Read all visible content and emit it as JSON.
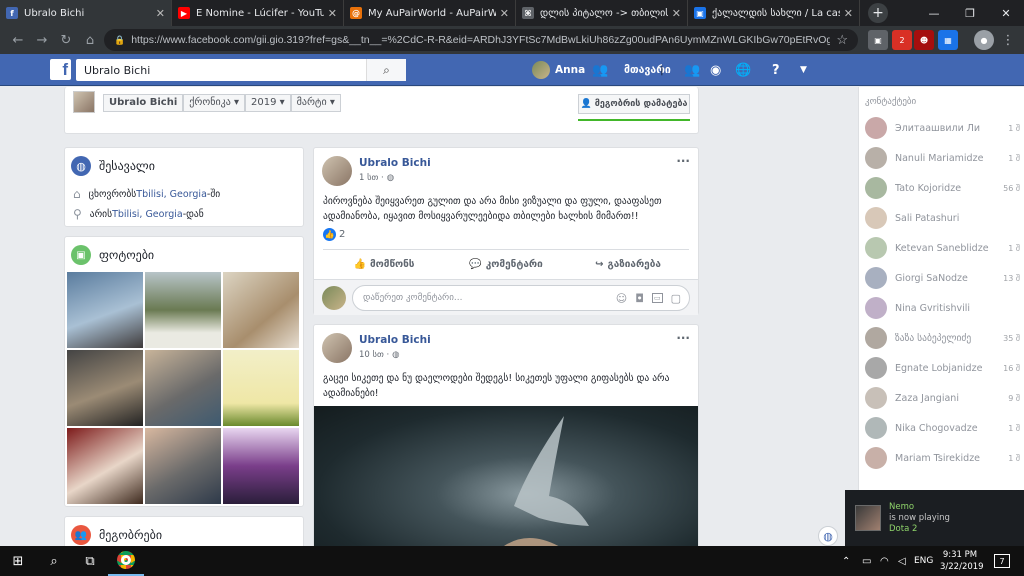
{
  "browser": {
    "tabs": [
      {
        "title": "Ubralo Bichi",
        "fav_color": "#4267b2",
        "fav_glyph": "f",
        "active": true
      },
      {
        "title": "E Nomine - Lúcifer - YouTube",
        "fav_color": "#ff0000",
        "fav_glyph": "▶",
        "active": false
      },
      {
        "title": "My AuPairWorld - AuPairWorld",
        "fav_color": "#e8710a",
        "fav_glyph": "@",
        "active": false
      },
      {
        "title": "დლის პიტალო -> თბილის",
        "fav_color": "#5f6368",
        "fav_glyph": "⌘",
        "active": false
      },
      {
        "title": "ქალალდის სახლი / La casa",
        "fav_color": "#1a73e8",
        "fav_glyph": "▣",
        "active": false
      }
    ],
    "new_tab": "+",
    "window_controls": [
      "—",
      "❐",
      "✕"
    ],
    "nav": {
      "back": "←",
      "forward": "→",
      "reload": "↻",
      "home": "⌂"
    },
    "url": "https://www.facebook.com/gii.gio.319?fref=gs&__tn__=%2CdC-R-R&eid=ARDhJ3YFtSc7MdBwLkiUh86zZg00udPAn6UymMZnWLGKIbGw70pEtRvOgV...",
    "lock": "🔒",
    "star": "☆",
    "ext_badge": "2"
  },
  "fb": {
    "search_value": "Ubralo Bichi",
    "user_name": "Anna",
    "home_label": "მთავარი"
  },
  "timeline_nav": {
    "name": "Ubralo Bichi",
    "sel1": "ქრონიკა",
    "sel2": "2019",
    "sel3": "მარტი",
    "add_friend": "მეგობრის დამატება"
  },
  "intro": {
    "title": "შესავალი",
    "lives_prefix": "ცხოვრობს ",
    "lives_place": "Tbilisi, Georgia",
    "lives_suffix": "-ში",
    "from_prefix": "არის ",
    "from_place": "Tbilisi, Georgia",
    "from_suffix": "-დან"
  },
  "photos": {
    "title": "ფოტოები"
  },
  "friends": {
    "title": "მეგობრები"
  },
  "post1": {
    "author": "Ubralo Bichi",
    "time": "1 სთ ·",
    "text": "პიროვნება შეიყვარეთ გულით და არა მისი ვიზუალი და ფული, დააფასეთ ადამიანობა, იყავით მოსიყვარულეებიდა თბილები ხალხის მიმართ!!",
    "likes": "2",
    "like_label": "მომწონს",
    "comment_label": "კომენტარი",
    "share_label": "გაზიარება",
    "comment_placeholder": "დაწერეთ კომენტარი..."
  },
  "post2": {
    "author": "Ubralo Bichi",
    "time": "10 სთ ·",
    "text": "გაცეი სიკეთე და ნუ დაელოდები შედეგს! სიკეთეს უფალი გიფასებს და არა ადამიანები!"
  },
  "chat": {
    "header": "კონტაქტები",
    "contacts": [
      {
        "name": "Элитаашвили Ли",
        "time": "1 შ"
      },
      {
        "name": "Nanuli Mariamidze",
        "time": "1 შ"
      },
      {
        "name": "Tato Kojoridze",
        "time": "56 შ"
      },
      {
        "name": "Sali Patashuri",
        "time": ""
      },
      {
        "name": "Ketevan Saneblidze",
        "time": "1 შ"
      },
      {
        "name": "Giorgi SaNodze",
        "time": "13 შ"
      },
      {
        "name": "Nina Gvritishvili",
        "time": ""
      },
      {
        "name": "ზაზა საბეპელიძე",
        "time": "35 შ"
      },
      {
        "name": "Egnate Lobjanidze",
        "time": "16 შ"
      },
      {
        "name": "Zaza Jangiani",
        "time": "9 შ"
      },
      {
        "name": "Nika Chogovadze",
        "time": "1 შ"
      },
      {
        "name": "Mariam Tsirekidze",
        "time": "1 შ"
      }
    ]
  },
  "toast": {
    "name": "Nemo",
    "status": "is now playing",
    "game": "Dota 2"
  },
  "taskbar": {
    "start": "⊞",
    "search": "⌕",
    "taskview": "⧉",
    "lang": "ENG",
    "time": "9:31 PM",
    "date": "3/22/2019",
    "notif_count": "7"
  }
}
